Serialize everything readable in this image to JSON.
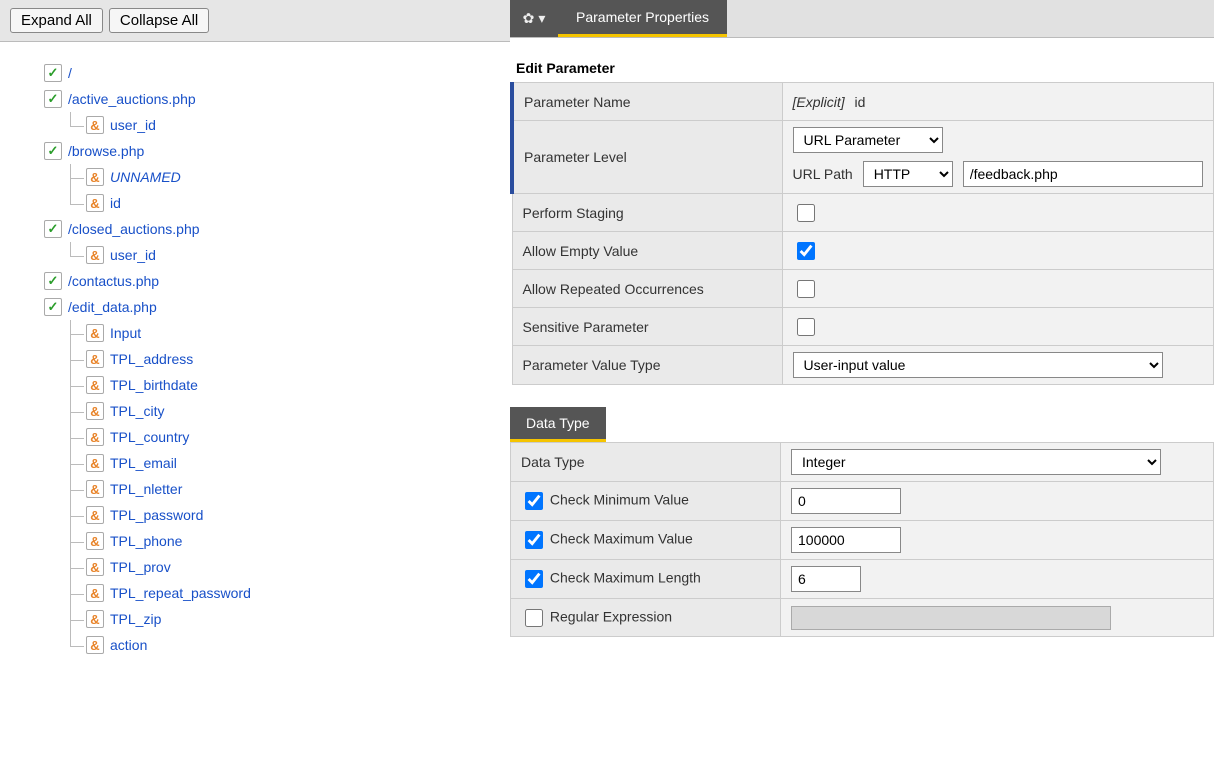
{
  "toolbar": {
    "expand_all": "Expand All",
    "collapse_all": "Collapse All"
  },
  "tree": [
    {
      "type": "file",
      "label": "/",
      "children": []
    },
    {
      "type": "file",
      "label": "/active_auctions.php",
      "children": [
        {
          "type": "param",
          "label": "user_id"
        }
      ]
    },
    {
      "type": "file",
      "label": "/browse.php",
      "children": [
        {
          "type": "param",
          "label": "UNNAMED",
          "italic": true
        },
        {
          "type": "param",
          "label": "id"
        }
      ]
    },
    {
      "type": "file",
      "label": "/closed_auctions.php",
      "children": [
        {
          "type": "param",
          "label": "user_id"
        }
      ]
    },
    {
      "type": "file",
      "label": "/contactus.php",
      "children": []
    },
    {
      "type": "file",
      "label": "/edit_data.php",
      "children": [
        {
          "type": "param",
          "label": "Input"
        },
        {
          "type": "param",
          "label": "TPL_address"
        },
        {
          "type": "param",
          "label": "TPL_birthdate"
        },
        {
          "type": "param",
          "label": "TPL_city"
        },
        {
          "type": "param",
          "label": "TPL_country"
        },
        {
          "type": "param",
          "label": "TPL_email"
        },
        {
          "type": "param",
          "label": "TPL_nletter"
        },
        {
          "type": "param",
          "label": "TPL_password"
        },
        {
          "type": "param",
          "label": "TPL_phone"
        },
        {
          "type": "param",
          "label": "TPL_prov"
        },
        {
          "type": "param",
          "label": "TPL_repeat_password"
        },
        {
          "type": "param",
          "label": "TPL_zip"
        },
        {
          "type": "param",
          "label": "action"
        }
      ]
    }
  ],
  "tabs": {
    "main": "Parameter Properties"
  },
  "edit": {
    "heading": "Edit Parameter",
    "rows": {
      "name_label": "Parameter Name",
      "name_prefix": "[Explicit]",
      "name_value": "id",
      "level_label": "Parameter Level",
      "level_select": "URL Parameter",
      "url_path_label": "URL Path",
      "url_path_protocol": "HTTP",
      "url_path_value": "/feedback.php",
      "staging_label": "Perform Staging",
      "staging_checked": false,
      "empty_label": "Allow Empty Value",
      "empty_checked": true,
      "repeated_label": "Allow Repeated Occurrences",
      "repeated_checked": false,
      "sensitive_label": "Sensitive Parameter",
      "sensitive_checked": false,
      "valtype_label": "Parameter Value Type",
      "valtype_select": "User-input value"
    }
  },
  "datatype": {
    "tab": "Data Type",
    "rows": {
      "type_label": "Data Type",
      "type_select": "Integer",
      "min_label": "Check Minimum Value",
      "min_checked": true,
      "min_value": "0",
      "max_label": "Check Maximum Value",
      "max_checked": true,
      "max_value": "100000",
      "len_label": "Check Maximum Length",
      "len_checked": true,
      "len_value": "6",
      "regex_label": "Regular Expression",
      "regex_checked": false
    }
  },
  "icons": {
    "file_glyph": "✓",
    "param_glyph": "&",
    "gear_glyph": "✿",
    "caret_glyph": "▾"
  }
}
